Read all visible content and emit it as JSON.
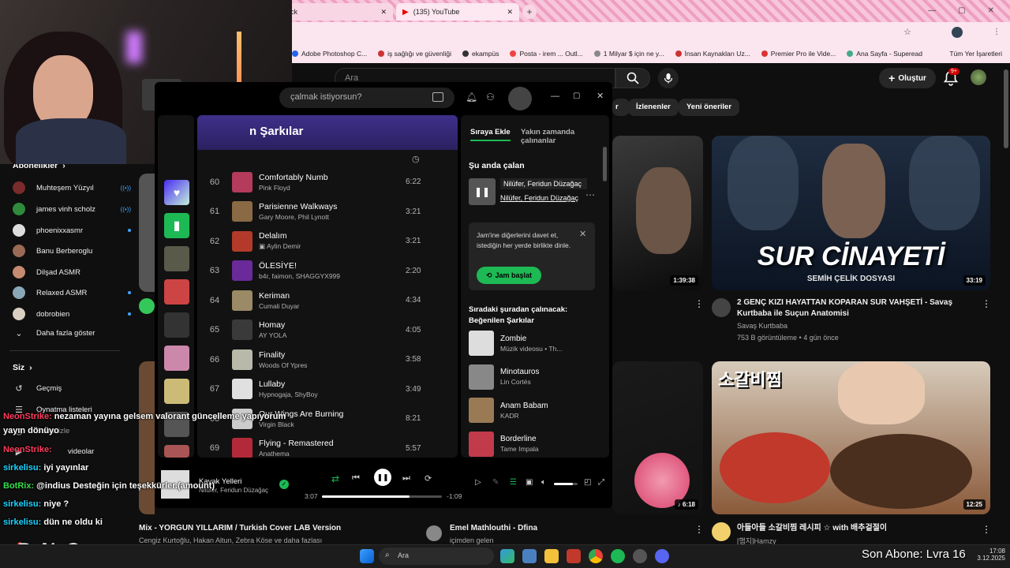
{
  "browser": {
    "tabs": [
      {
        "label": "ck"
      },
      {
        "label": "(135) YouTube"
      }
    ],
    "bookmarks": [
      "Adobe Photoshop C...",
      "iş sağlığı ve güvenliği",
      "ekampüs",
      "Posta - irem ... Outl...",
      "1 Milyar $ için ne y...",
      "İnsan Kaynakları Uz...",
      "Premier Pro ile Vide...",
      "Ana Sayfa - Superead"
    ],
    "bookmarks_all": "Tüm Yer İşaretleri"
  },
  "youtube": {
    "search_placeholder": "Ara",
    "create_label": "Oluştur",
    "notif_badge": "9+",
    "chips": [
      "İzlenenler",
      "Yeni öneriler"
    ],
    "sidebar": {
      "subs_header": "Abonelikler",
      "subs": [
        {
          "name": "Muhteşem Yüzyıl",
          "color": "#7a2b2b"
        },
        {
          "name": "james vinh scholz",
          "color": "#2f8a3c"
        },
        {
          "name": "phoenixxasmr",
          "color": "#ddd"
        },
        {
          "name": "Banu Berberoglu",
          "color": "#9a6a55"
        },
        {
          "name": "Dilşad ASMR",
          "color": "#c58a70"
        },
        {
          "name": "Relaxed ASMR",
          "color": "#8aa7b8"
        },
        {
          "name": "dobrobien",
          "color": "#d9d0c2"
        }
      ],
      "show_more": "Daha fazla göster",
      "you_header": "Siz",
      "you_items": [
        "Geçmiş",
        "Oynatma listeleri",
        "Sonra izle",
        "videolar"
      ]
    },
    "videos": [
      {
        "title": "2 GENÇ KIZI HAYATTAN KOPARAN SUR VAHŞETİ - Savaş Kurtbaba ile Suçun Anatomisi",
        "channel": "Savaş Kurtbaba",
        "meta": "753 B görüntüleme • 4 gün önce",
        "duration": "33:19",
        "thumb_title": "SUR CİNAYETİ",
        "thumb_sub": "SEMİH ÇELİK DOSYASI"
      },
      {
        "duration": "1:39:38"
      },
      {
        "duration": "6:18"
      },
      {
        "title": "아들아들 소갈비찜 레시피 ☆ with 배추겉절이",
        "channel": "[햄지]Hamzy",
        "duration": "12:25",
        "thumb_title": "소갈비찜"
      },
      {
        "title": "Emel Mathlouthi - Dfina",
        "channel": "içimden gelen"
      },
      {
        "title": "Mix - YORGUN YILLARIM / Turkish Cover LAB Version",
        "channel": "Cengiz Kurtoğlu, Hakan Altun, Zebra Köse ve daha fazlası"
      }
    ]
  },
  "spotify": {
    "search_placeholder": "çalmak istiyorsun?",
    "playlist_title": "n Şarkılar",
    "tracks": [
      {
        "num": "60",
        "title": "Comfortably Numb",
        "artist": "Pink Floyd",
        "dur": "6:22",
        "color": "#b43b5b"
      },
      {
        "num": "61",
        "title": "Parisienne Walkways",
        "artist": "Gary Moore, Phil Lynott",
        "dur": "3:21",
        "color": "#8a6a44"
      },
      {
        "num": "62",
        "title": "Delalım",
        "artist": "Aylin Demir",
        "dur": "3:21",
        "color": "#b33a2a",
        "video": true
      },
      {
        "num": "63",
        "title": "ÖLESİYE!",
        "artist": "b4r, faimon, SHAGGYX999",
        "dur": "2:20",
        "color": "#6a2a9a"
      },
      {
        "num": "64",
        "title": "Keriman",
        "artist": "Cumali Duyar",
        "dur": "4:34",
        "color": "#9a8a66"
      },
      {
        "num": "65",
        "title": "Homay",
        "artist": "AY YOLA",
        "dur": "4:05",
        "color": "#3a3a3a"
      },
      {
        "num": "66",
        "title": "Finality",
        "artist": "Woods Of Ypres",
        "dur": "3:58",
        "color": "#b9b9a9"
      },
      {
        "num": "67",
        "title": "Lullaby",
        "artist": "Hypnogaja, ShyBoy",
        "dur": "3:49",
        "color": "#e0e0e0"
      },
      {
        "num": "68",
        "title": "Our Wings Are Burning",
        "artist": "Virgin Black",
        "dur": "8:21",
        "color": "#cccccc"
      },
      {
        "num": "69",
        "title": "Flying - Remastered",
        "artist": "Anathema",
        "dur": "5:57",
        "color": "#b22a3a"
      }
    ],
    "tabs": [
      "Sıraya Ekle",
      "Yakın zamanda çalınanlar"
    ],
    "now_playing_header": "Şu anda çalan",
    "now_playing_title": "Nilüfer, Feridun Düzağaç",
    "now_playing_artist": "Nilüfer, Feridun Düzağaç",
    "jam_text": "Jam'ine diğerlerini davet et, istediğin her yerde birlikte dinle.",
    "jam_button": "Jam başlat",
    "next_header": "Sıradaki şuradan çalınacak: Beğenilen Şarkılar",
    "queue": [
      {
        "title": "Zombie",
        "artist": "Müzik videosu • Th...",
        "color": "#ddd"
      },
      {
        "title": "Minotauros",
        "artist": "Lin Cortés",
        "color": "#888"
      },
      {
        "title": "Anam Babam",
        "artist": "KADR",
        "color": "#9a7a55"
      },
      {
        "title": "Borderline",
        "artist": "Tame Impala",
        "color": "#c23b4b"
      }
    ],
    "player": {
      "title": "Kavak Yelleri",
      "artist": "Nilüfer, Feridun Düzağaç",
      "elapsed": "3:07",
      "remaining": "-1:09",
      "progress": 0.73,
      "volume": 0.8
    }
  },
  "chat": [
    {
      "user": "NeonStrike:",
      "msg": " nezaman yayına gelsem valorant güncelleme yapıyorum",
      "cls": "cn"
    },
    {
      "user": "",
      "msg": "yayın dönüyo",
      "cls": "cn"
    },
    {
      "user": "NeonStrike:",
      "msg": "",
      "cls": "cn"
    },
    {
      "user": "sirkelisu:",
      "msg": " iyi yayınlar",
      "cls": "cn2"
    },
    {
      "user": "BotRix:",
      "msg": " @indius Desteğin için teşekkürler.(amount)",
      "cls": "cn3"
    },
    {
      "user": "sirkelisu:",
      "msg": " niye ?",
      "cls": "cn2"
    },
    {
      "user": "sirkelisu:",
      "msg": " dün ne oldu ki",
      "cls": "cn2"
    }
  ],
  "stream": {
    "logo": "ByNoGame",
    "sub_goal": "Son Abone: Lvra 16"
  },
  "taskbar": {
    "search": "Ara",
    "time": "17:08",
    "date": "3.12.2025"
  }
}
